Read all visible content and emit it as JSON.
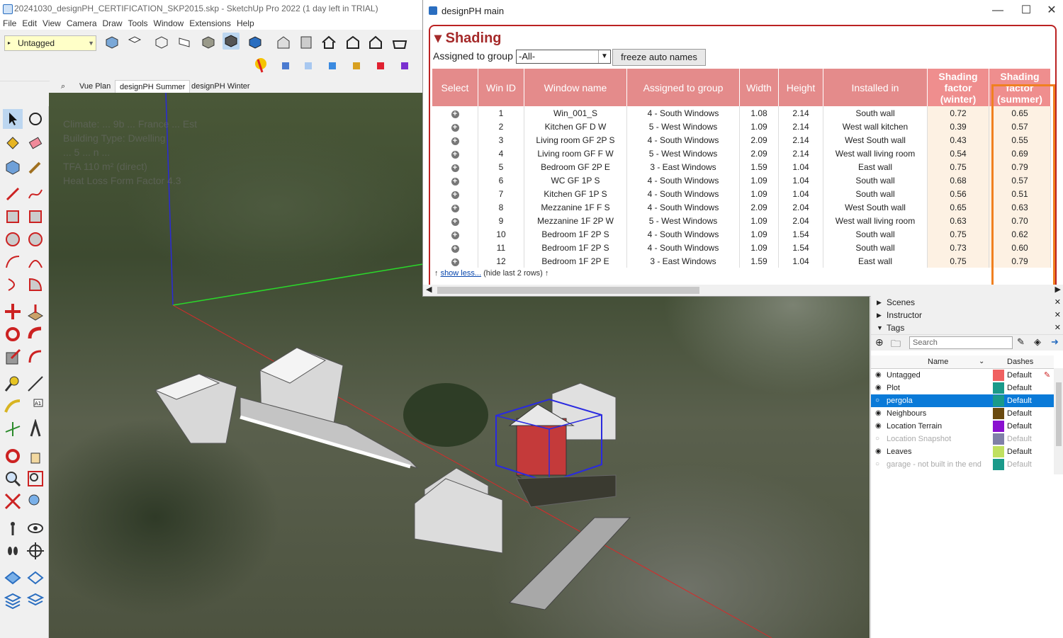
{
  "app": {
    "title": "20241030_designPH_CERTIFICATION_SKP2015.skp - SketchUp Pro 2022 (1 day left in TRIAL)",
    "menu": [
      "File",
      "Edit",
      "View",
      "Camera",
      "Draw",
      "Tools",
      "Window",
      "Extensions",
      "Help"
    ],
    "tag_selector": "Untagged",
    "scene_tabs": [
      "Vue Plan",
      "designPH Summer",
      "designPH Winter"
    ],
    "active_scene": "designPH Summer",
    "viewport_overlay": [
      "Climate: ... 9b ... France ... Est",
      "Building Type: Dwelling",
      "... 5 ... n ...",
      "TFA 110 m² (direct)",
      "Heat Loss Form Factor 4.3"
    ]
  },
  "designph": {
    "window_title": "designPH main",
    "section_title": "Shading",
    "assigned_label": "Assigned to group",
    "assigned_value": "-All-",
    "freeze_button": "freeze auto names",
    "columns": [
      "Select",
      "Win ID",
      "Window name",
      "Assigned to group",
      "Width",
      "Height",
      "Installed in",
      "Shading factor (winter)",
      "Shading factor (summer)"
    ],
    "rows": [
      {
        "id": "1",
        "name": "Win_001_S",
        "group": "4 - South Windows",
        "width": "1.08",
        "height": "2.14",
        "installed": "South wall",
        "winter": "0.72",
        "summer": "0.65"
      },
      {
        "id": "2",
        "name": "Kitchen GF D W",
        "group": "5 - West Windows",
        "width": "1.09",
        "height": "2.14",
        "installed": "West wall kitchen",
        "winter": "0.39",
        "summer": "0.57"
      },
      {
        "id": "3",
        "name": "Living room GF 2P S",
        "group": "4 - South Windows",
        "width": "2.09",
        "height": "2.14",
        "installed": "West South wall",
        "winter": "0.43",
        "summer": "0.55"
      },
      {
        "id": "4",
        "name": "Living room GF F W",
        "group": "5 - West Windows",
        "width": "2.09",
        "height": "2.14",
        "installed": "West wall living room",
        "winter": "0.54",
        "summer": "0.69"
      },
      {
        "id": "5",
        "name": "Bedroom GF 2P E",
        "group": "3 - East Windows",
        "width": "1.59",
        "height": "1.04",
        "installed": "East wall",
        "winter": "0.75",
        "summer": "0.79"
      },
      {
        "id": "6",
        "name": "WC GF 1P S",
        "group": "4 - South Windows",
        "width": "1.09",
        "height": "1.04",
        "installed": "South wall",
        "winter": "0.68",
        "summer": "0.57"
      },
      {
        "id": "7",
        "name": "Kitchen GF 1P S",
        "group": "4 - South Windows",
        "width": "1.09",
        "height": "1.04",
        "installed": "South wall",
        "winter": "0.56",
        "summer": "0.51"
      },
      {
        "id": "8",
        "name": "Mezzanine 1F F S",
        "group": "4 - South Windows",
        "width": "2.09",
        "height": "2.04",
        "installed": "West South wall",
        "winter": "0.65",
        "summer": "0.63"
      },
      {
        "id": "9",
        "name": "Mezzanine 1F 2P W",
        "group": "5 - West Windows",
        "width": "1.09",
        "height": "2.04",
        "installed": "West wall living room",
        "winter": "0.63",
        "summer": "0.70"
      },
      {
        "id": "10",
        "name": "Bedroom 1F 2P S",
        "group": "4 - South Windows",
        "width": "1.09",
        "height": "1.54",
        "installed": "South wall",
        "winter": "0.75",
        "summer": "0.62"
      },
      {
        "id": "11",
        "name": "Bedroom 1F 2P S",
        "group": "4 - South Windows",
        "width": "1.09",
        "height": "1.54",
        "installed": "South wall",
        "winter": "0.73",
        "summer": "0.60"
      },
      {
        "id": "12",
        "name": "Bedroom 1F 2P E",
        "group": "3 - East Windows",
        "width": "1.59",
        "height": "1.04",
        "installed": "East wall",
        "winter": "0.75",
        "summer": "0.79"
      }
    ],
    "show_less_prefix": "↑",
    "show_less_link": "show less...",
    "show_less_suffix": "(hide last 2 rows) ↑"
  },
  "tray": {
    "panels": [
      "Scenes",
      "Instructor",
      "Tags"
    ],
    "search_placeholder": "Search",
    "col_name": "Name",
    "col_dashes": "Dashes",
    "tags": [
      {
        "name": "Untagged",
        "color": "#f06060",
        "dashes": "Default",
        "visible": true
      },
      {
        "name": "Plot",
        "color": "#1a9a8a",
        "dashes": "Default",
        "visible": true
      },
      {
        "name": "pergola",
        "color": "#1a9a8a",
        "dashes": "Default",
        "visible": false,
        "selected": true
      },
      {
        "name": "Neighbours",
        "color": "#6a4a10",
        "dashes": "Default",
        "visible": true
      },
      {
        "name": "Location Terrain",
        "color": "#8a10d0",
        "dashes": "Default",
        "visible": true
      },
      {
        "name": "Location Snapshot",
        "color": "#8080a8",
        "dashes": "Default",
        "visible": false
      },
      {
        "name": "Leaves",
        "color": "#c0e060",
        "dashes": "Default",
        "visible": true
      },
      {
        "name": "garage - not built in the end",
        "color": "#1a9a8a",
        "dashes": "Default",
        "visible": false
      }
    ]
  }
}
